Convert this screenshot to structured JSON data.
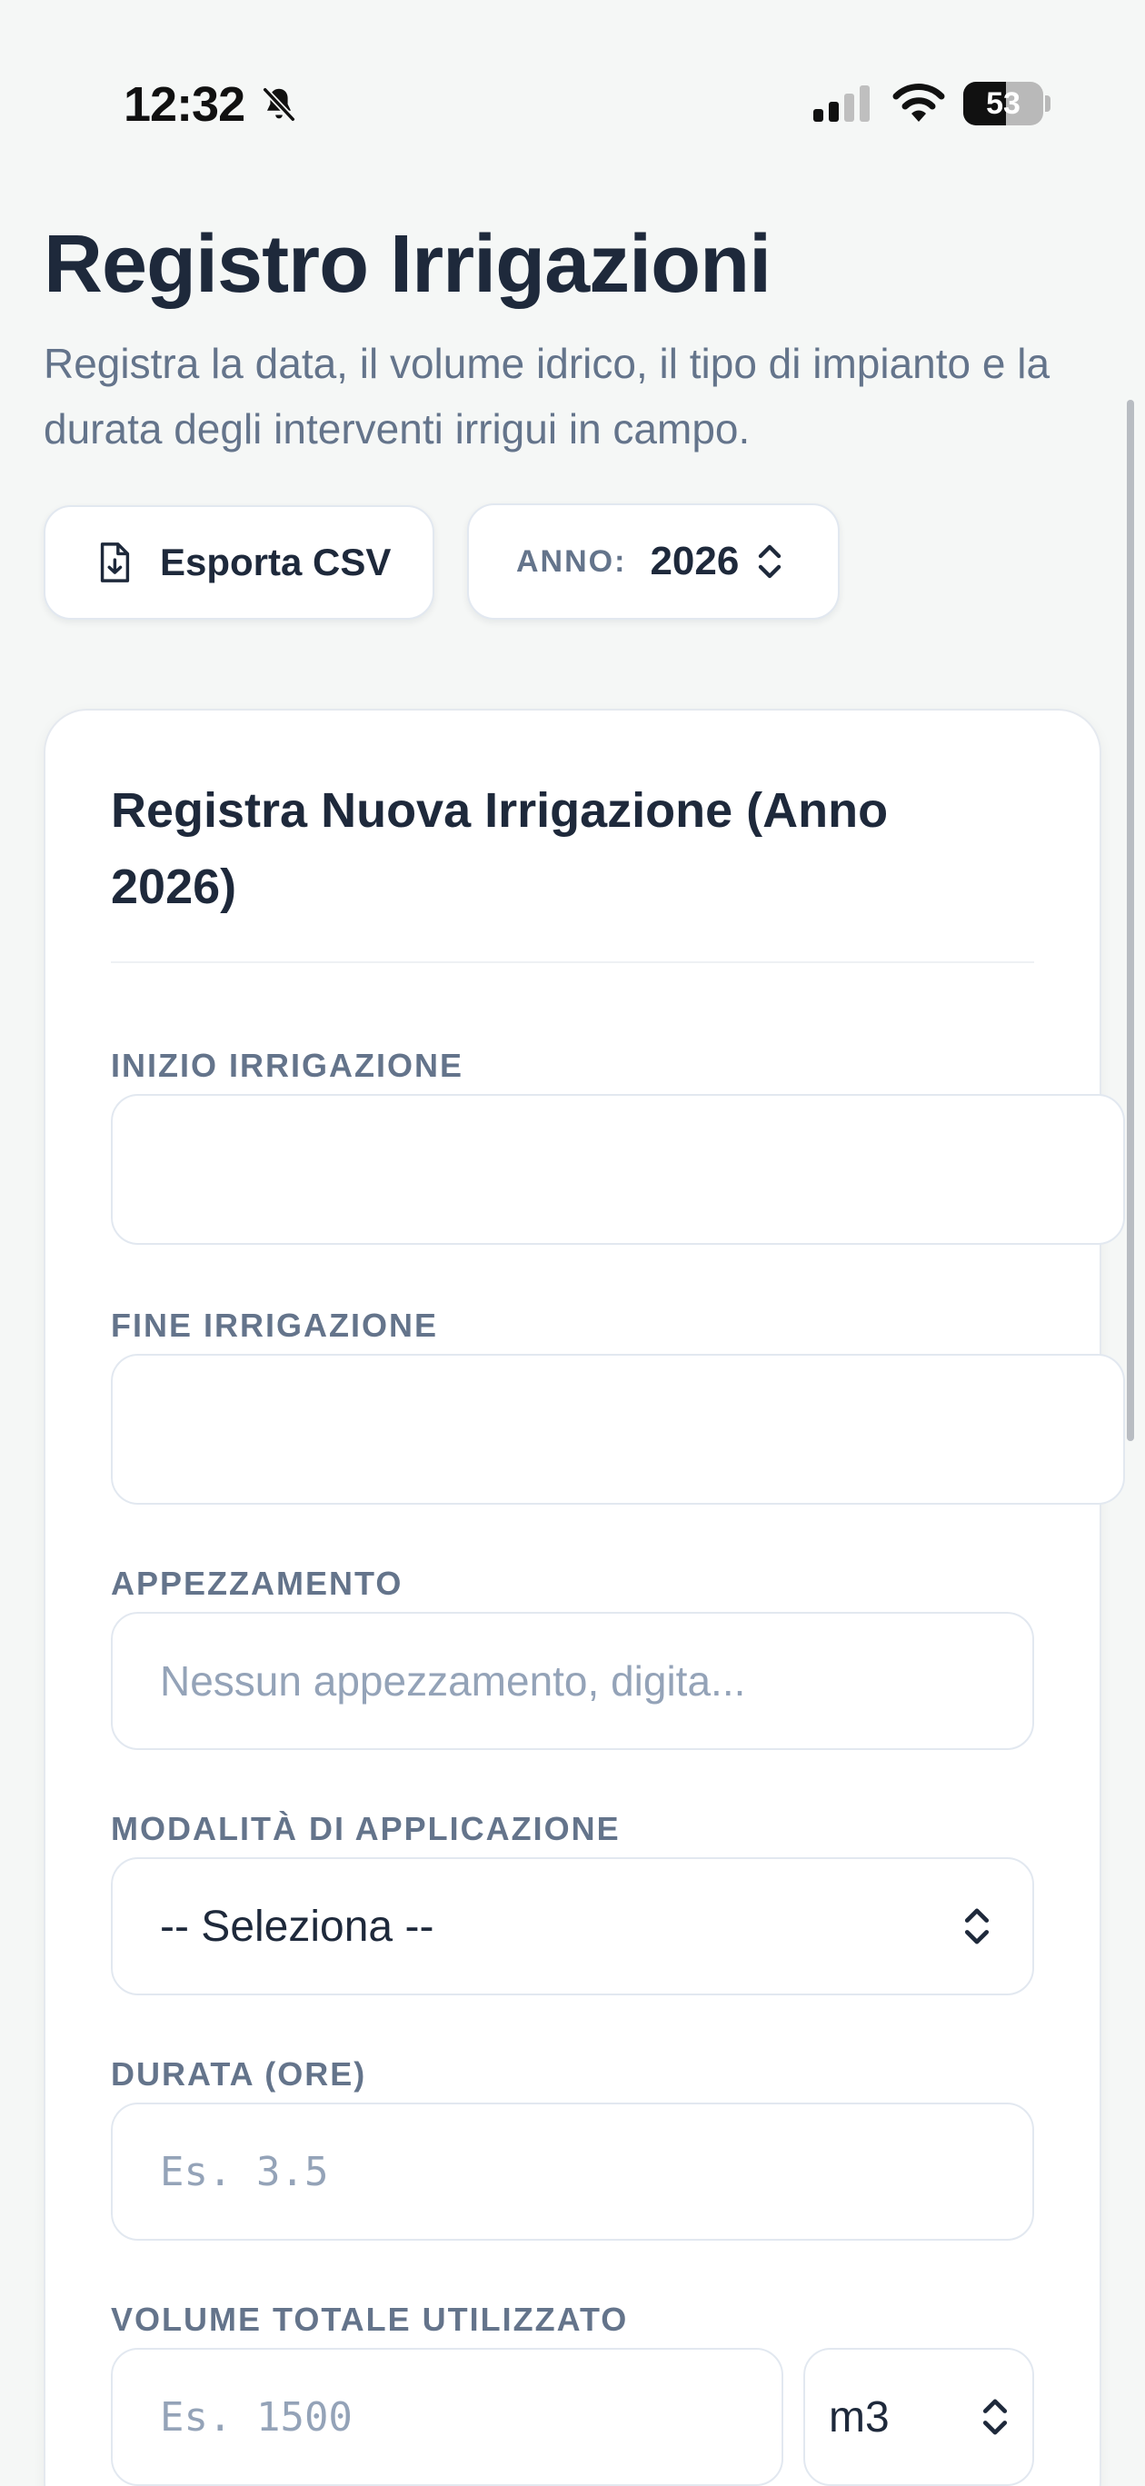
{
  "status_bar": {
    "time": "12:32",
    "battery_level": "53",
    "battery_fraction": 0.53,
    "icons": [
      "bell-muted-icon",
      "cellular-signal-icon",
      "wifi-icon",
      "battery-icon"
    ]
  },
  "header": {
    "title": "Registro Irrigazioni",
    "subtitle": "Registra la data, il volume idrico, il tipo di impianto e la durata degli interventi irrigui in campo."
  },
  "toolbar": {
    "export_label": "Esporta CSV",
    "year_label": "ANNO:",
    "year_value": "2026"
  },
  "form": {
    "title": "Registra Nuova Irrigazione (Anno 2026)",
    "fields": {
      "start": {
        "label": "INIZIO IRRIGAZIONE",
        "value": ""
      },
      "end": {
        "label": "FINE IRRIGAZIONE",
        "value": ""
      },
      "plot": {
        "label": "APPEZZAMENTO",
        "placeholder": "Nessun appezzamento, digita..."
      },
      "mode": {
        "label": "MODALITÀ DI APPLICAZIONE",
        "selected": "-- Seleziona --"
      },
      "duration": {
        "label": "DURATA (ORE)",
        "placeholder": "Es. 3.5"
      },
      "volume": {
        "label": "VOLUME TOTALE UTILIZZATO",
        "placeholder": "Es. 1500",
        "unit": "m3"
      }
    }
  },
  "colors": {
    "background": "#f5f7f6",
    "text_primary": "#1e293b",
    "text_muted": "#64748b",
    "placeholder": "#94a3b8",
    "border": "#e2e8f0"
  }
}
